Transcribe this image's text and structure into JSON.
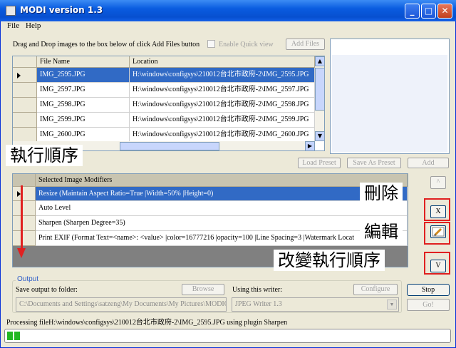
{
  "window": {
    "title": "MODI version 1.3",
    "min": "_",
    "max": "□",
    "close": "✕"
  },
  "menu": {
    "file": "File",
    "help": "Help"
  },
  "files": {
    "instruction": "Drag and Drop images to the box below of click Add Files button",
    "quick_view": "Enable Quick view",
    "add_files": "Add Files",
    "col_name": "File Name",
    "col_location": "Location",
    "rows": [
      {
        "name": "IMG_2595.JPG",
        "location": "H:\\windows\\configsys\\210012台北市政府-2\\IMG_2595.JPG"
      },
      {
        "name": "IMG_2597.JPG",
        "location": "H:\\windows\\configsys\\210012台北市政府-2\\IMG_2597.JPG"
      },
      {
        "name": "IMG_2598.JPG",
        "location": "H:\\windows\\configsys\\210012台北市政府-2\\IMG_2598.JPG"
      },
      {
        "name": "IMG_2599.JPG",
        "location": "H:\\windows\\configsys\\210012台北市政府-2\\IMG_2599.JPG"
      },
      {
        "name": "IMG_2600.JPG",
        "location": "H:\\windows\\configsys\\210012台北市政府-2\\IMG_2600.JPG"
      }
    ]
  },
  "preset": {
    "load": "Load Preset",
    "save": "Save As Preset",
    "add": "Add"
  },
  "modifiers": {
    "header": "Selected Image Modifiers",
    "rows": [
      "Resize (Maintain Aspect Ratio=True |Width=50% |Height=0)",
      "Auto Level",
      "Sharpen (Sharpen Degree=35)",
      "Print EXIF (Format Text=<name>: <value> |color=16777216 |opacity=100 |Line Spacing=3 |Watermark Locat"
    ],
    "up": "^",
    "delete": "X",
    "down": "V"
  },
  "annotations": {
    "order": "執行順序",
    "delete": "刪除",
    "edit": "編輯",
    "change_order": "改變執行順序"
  },
  "output": {
    "legend": "Output",
    "save_label": "Save output to folder:",
    "folder": "C:\\Documents and Settings\\satzeng\\My Documents\\My Pictures\\MODIOu",
    "browse": "Browse",
    "writer_label": "Using this writer:",
    "writer": "JPEG Writer 1.3",
    "configure": "Configure"
  },
  "actions": {
    "stop": "Stop",
    "go": "Go!"
  },
  "status": {
    "text": "Processing fileH:\\windows\\configsys\\210012台北市政府-2\\IMG_2595.JPG using plugin Sharpen",
    "progress": 0.03
  },
  "colors": {
    "selection": "#316ac5",
    "annotation_border": "#e02020",
    "progress": "#22b822"
  }
}
